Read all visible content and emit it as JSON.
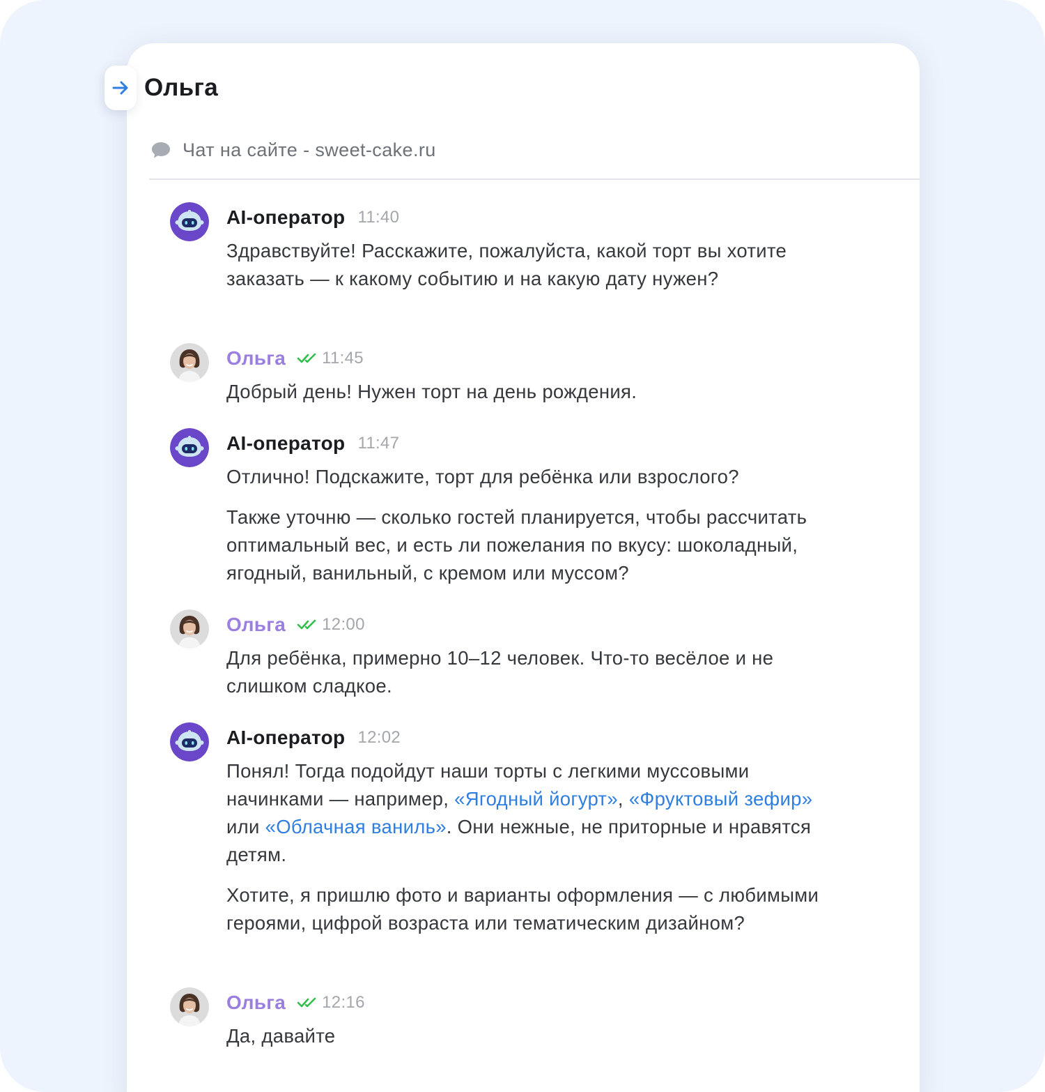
{
  "header": {
    "contact_name": "Ольга",
    "channel": "Чат на сайте - sweet-cake.ru"
  },
  "colors": {
    "background": "#eef4fd",
    "accent_blue": "#2f7fe0",
    "user_name": "#9b7fe0",
    "read_check": "#2fbf4a",
    "bot_avatar": "#6a46c8"
  },
  "messages": [
    {
      "sender": "AI-оператор",
      "role": "bot",
      "time": "11:40",
      "paragraphs": [
        [
          {
            "text": "Здравствуйте! Расскажите, пожалуйста, какой торт вы хотите заказать — к какому событию и на какую дату нужен?"
          }
        ]
      ]
    },
    {
      "sender": "Ольга",
      "role": "user",
      "time": "11:45",
      "status": "read",
      "paragraphs": [
        [
          {
            "text": "Добрый день! Нужен торт на день рождения."
          }
        ]
      ]
    },
    {
      "sender": "AI-оператор",
      "role": "bot",
      "time": "11:47",
      "paragraphs": [
        [
          {
            "text": "Отлично! Подскажите, торт для ребёнка или взрослого?"
          }
        ],
        [
          {
            "text": "Также уточню — сколько гостей планируется, чтобы рассчитать оптимальный вес, и есть ли пожелания по вкусу: шоколадный, ягодный, ванильный, с кремом или муссом?"
          }
        ]
      ]
    },
    {
      "sender": "Ольга",
      "role": "user",
      "time": "12:00",
      "status": "read",
      "paragraphs": [
        [
          {
            "text": "Для ребёнка, примерно 10–12 человек. Что-то весёлое и не слишком сладкое."
          }
        ]
      ]
    },
    {
      "sender": "AI-оператор",
      "role": "bot",
      "time": "12:02",
      "paragraphs": [
        [
          {
            "text": "Понял! Тогда подойдут наши торты с легкими муссовыми начинками — например, "
          },
          {
            "text": "«Ягодный йогурт»",
            "link": true
          },
          {
            "text": ", "
          },
          {
            "text": "«Фруктовый зефир»",
            "link": true
          },
          {
            "text": " или "
          },
          {
            "text": "«Облачная ваниль»",
            "link": true
          },
          {
            "text": ". Они нежные, не приторные и нравятся детям."
          }
        ],
        [
          {
            "text": "Хотите, я пришлю фото и варианты оформления — с любимыми героями, цифрой возраста или тематическим дизайном?"
          }
        ]
      ]
    },
    {
      "sender": "Ольга",
      "role": "user",
      "time": "12:16",
      "status": "read",
      "paragraphs": [
        [
          {
            "text": "Да, давайте"
          }
        ]
      ]
    }
  ]
}
